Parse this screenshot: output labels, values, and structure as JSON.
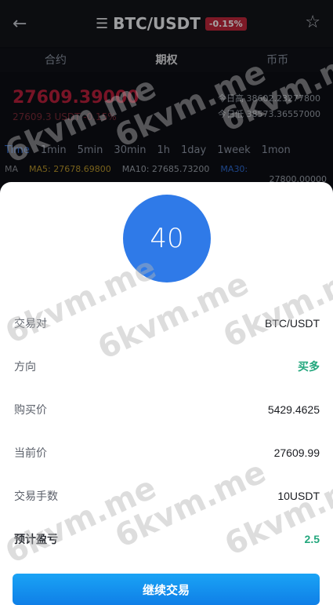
{
  "header": {
    "back_icon": "back-arrow-icon",
    "menu_icon": "list-icon",
    "pair": "BTC/USDT",
    "change": "-0.15%",
    "star_icon": "star-icon"
  },
  "tabs": [
    {
      "label": "合约"
    },
    {
      "label": "期权"
    },
    {
      "label": "币币"
    }
  ],
  "ticker": {
    "price": "27609.39000",
    "sub_price": "27609.3 USDT -0.15%",
    "stats": [
      "今日高 38602.23277800",
      "今日低 38573.36557000"
    ]
  },
  "timeframes": [
    "Time",
    "1min",
    "5min",
    "30min",
    "1h",
    "1day",
    "1week",
    "1mon"
  ],
  "ma": {
    "ma_label": "MA",
    "ma5": "MA5: 27678.69800",
    "ma10": "MA10: 27685.73200",
    "ma30": "MA30:",
    "right_value": "27800.00000"
  },
  "sheet": {
    "countdown": "40",
    "rows": [
      {
        "label": "交易对",
        "value": "BTC/USDT"
      },
      {
        "label": "方向",
        "value": "买多"
      },
      {
        "label": "购买价",
        "value": "5429.4625"
      },
      {
        "label": "当前价",
        "value": "27609.99"
      },
      {
        "label": "交易手数",
        "value": "10USDT"
      },
      {
        "label": "预计盈亏",
        "value": "2.5"
      }
    ],
    "cta": "继续交易"
  },
  "watermark": "6kvm.me",
  "colors": {
    "accent": "#2f7ae8",
    "profit": "#23a77d",
    "loss": "#c0273b",
    "button_top": "#1aa3f5",
    "button_bottom": "#0f7fe7"
  }
}
